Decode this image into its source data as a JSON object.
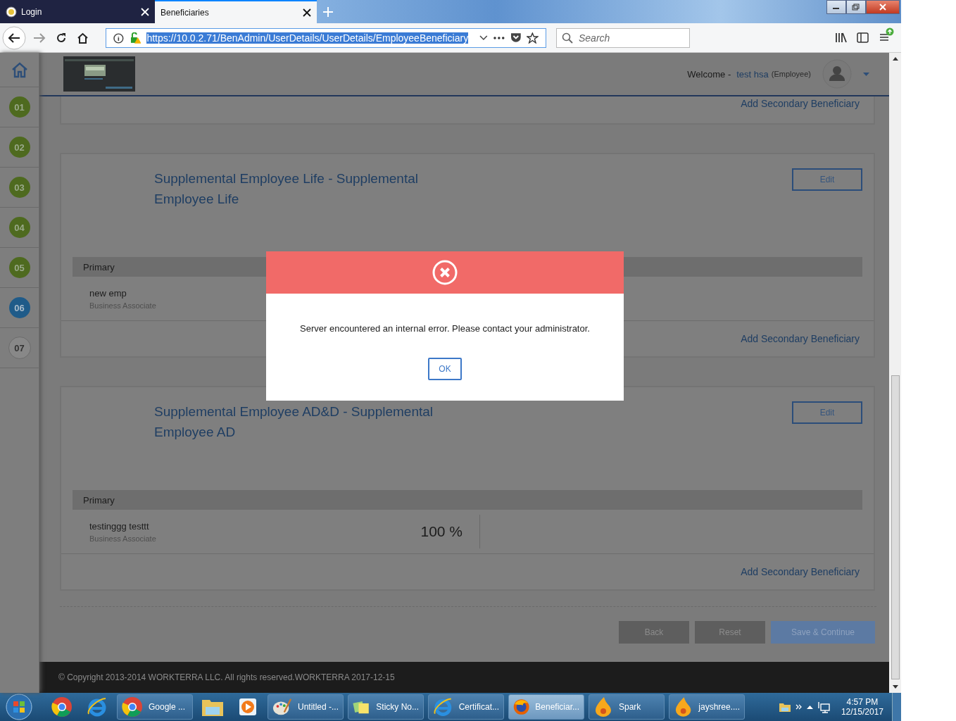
{
  "browser": {
    "tabs": [
      {
        "label": "Login",
        "selected": false
      },
      {
        "label": "Beneficiaries",
        "selected": true
      }
    ],
    "url": "https://10.0.2.71/BenAdmin/UserDetails/UserDetails/EmployeeBeneficiary",
    "search": {
      "placeholder": "Search"
    }
  },
  "header": {
    "welcome": "Welcome -",
    "user": "test hsa",
    "role": "(Employee)"
  },
  "steps": [
    {
      "label": "01",
      "completed": true,
      "selected": false
    },
    {
      "label": "02",
      "completed": true,
      "selected": false
    },
    {
      "label": "03",
      "completed": true,
      "selected": false
    },
    {
      "label": "04",
      "completed": true,
      "selected": false
    },
    {
      "label": "05",
      "completed": true,
      "selected": false
    },
    {
      "label": "06",
      "completed": false,
      "selected": true
    },
    {
      "label": "07",
      "completed": false,
      "selected": false
    }
  ],
  "first_card": {
    "link": "Add Secondary Beneficiary"
  },
  "plans": [
    {
      "title": "Supplemental Employee Life - Supplemental Employee Life",
      "edit": "Edit",
      "group": "Primary",
      "beneficiary": {
        "name": "new emp",
        "relation": "Business Associate"
      },
      "link": "Add Secondary Beneficiary"
    },
    {
      "title": "Supplemental Employee AD&D - Supplemental Employee AD",
      "edit": "Edit",
      "group": "Primary",
      "beneficiary": {
        "name": "testinggg testtt",
        "relation": "Business Associate",
        "percent": "100 %"
      },
      "link": "Add Secondary Beneficiary"
    }
  ],
  "actions": [
    {
      "label": "Back",
      "kind": "secondary"
    },
    {
      "label": "Reset",
      "kind": "secondary"
    },
    {
      "label": "Save & Continue",
      "kind": "primary"
    }
  ],
  "footer": "© Copyright 2013-2014 WORKTERRA LLC. All rights reserved.WORKTERRA 2017-12-15",
  "dialog": {
    "message": "Server encountered an internal error. Please contact your administrator.",
    "button": "OK"
  },
  "taskbar": {
    "items": [
      {
        "kind": "chrome",
        "selected": false
      },
      {
        "kind": "ie",
        "selected": false
      },
      {
        "kind": "chrome",
        "label": "Google ...",
        "selected": false
      },
      {
        "kind": "folder",
        "selected": false
      },
      {
        "kind": "media",
        "selected": false
      },
      {
        "kind": "paint",
        "label": "Untitled -...",
        "selected": false
      },
      {
        "kind": "sticky",
        "label": "Sticky No...",
        "selected": false
      },
      {
        "kind": "ie",
        "label": "Certificat...",
        "selected": false
      },
      {
        "kind": "firefox",
        "label": "Beneficiar...",
        "selected": true
      },
      {
        "kind": "spark",
        "label": "Spark",
        "selected": false
      },
      {
        "kind": "spark",
        "label": "jayshree....",
        "selected": false
      }
    ],
    "clock": {
      "time": "4:57 PM",
      "date": "12/15/2017"
    }
  }
}
